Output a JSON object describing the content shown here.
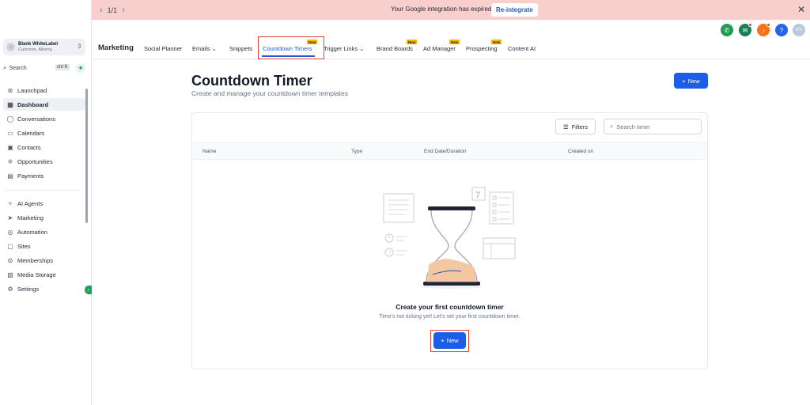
{
  "banner": {
    "pager": "1/1",
    "message": "Your Google integration has expired.",
    "action": "Re-integrate",
    "color": "#f8cfcd"
  },
  "sidebar": {
    "account_name": "Blank WhiteLabel",
    "account_location": "Canmore, Alberta",
    "search_label": "Search",
    "search_shortcut": "ctrl K",
    "items_primary": [
      {
        "label": "Launchpad",
        "icon": "rocket-icon"
      },
      {
        "label": "Dashboard",
        "icon": "dashboard-icon",
        "active": true
      },
      {
        "label": "Conversations",
        "icon": "chat-icon"
      },
      {
        "label": "Calendars",
        "icon": "calendar-icon"
      },
      {
        "label": "Contacts",
        "icon": "contacts-icon"
      },
      {
        "label": "Opportunities",
        "icon": "opportunities-icon"
      },
      {
        "label": "Payments",
        "icon": "payments-icon"
      }
    ],
    "items_secondary": [
      {
        "label": "AI Agents",
        "icon": "sparkle-icon"
      },
      {
        "label": "Marketing",
        "icon": "send-icon"
      },
      {
        "label": "Automation",
        "icon": "automation-icon"
      },
      {
        "label": "Sites",
        "icon": "sites-icon"
      },
      {
        "label": "Memberships",
        "icon": "membership-icon"
      },
      {
        "label": "Media Storage",
        "icon": "media-icon"
      },
      {
        "label": "Settings",
        "icon": "gear-icon"
      }
    ]
  },
  "topnav": {
    "brand": "Marketing",
    "tabs": [
      {
        "label": "Social Planner"
      },
      {
        "label": "Emails"
      },
      {
        "label": "Snippets"
      },
      {
        "label": "Countdown Timers",
        "badge": "New"
      },
      {
        "label": "Trigger Links"
      },
      {
        "label": "Brand Boards",
        "badge": "New"
      },
      {
        "label": "Ad Manager",
        "badge": "New"
      },
      {
        "label": "Prospecting",
        "badge": "New"
      },
      {
        "label": "Content AI"
      }
    ]
  },
  "header_icons": {
    "avatar_initials": "KV",
    "help": "?",
    "colors": {
      "phone": "#1f9d55",
      "megaphone": "#1a7f5a",
      "bell": "#f97316",
      "help": "#2563eb",
      "avatar": "#b9c9dc"
    }
  },
  "page": {
    "title": "Countdown Timer",
    "subtitle": "Create and manage your countdown timer templates",
    "new_button": "New",
    "filters_button": "Filters",
    "search_placeholder": "Search timer",
    "columns": [
      "Name",
      "Type",
      "End Date/Duration",
      "Created on"
    ],
    "empty_title": "Create your first countdown timer",
    "empty_subtitle": "Time's not ticking yet! Let's set your first countdown timer.",
    "empty_button": "New",
    "illustration_calendar_day": "7",
    "accent": "#1d5ee8",
    "highlight": "#e2453c"
  }
}
